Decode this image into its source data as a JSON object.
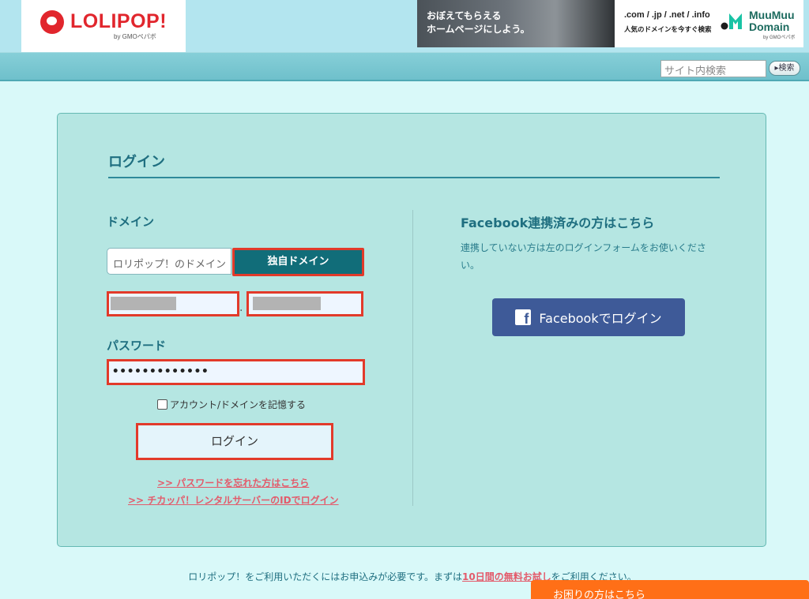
{
  "header": {
    "logo_text": "LOLIPOP!",
    "logo_sub": "by GMOペパボ",
    "banner": {
      "photo_text": "おぼえてもらえる\nホームページにしよう。",
      "tlds": ".com / .jp / .net / .info",
      "tagline": "人気のドメインを今すぐ検索",
      "brand": "MuuMuu\nDomain",
      "brand_sub": "by GMOペパボ"
    }
  },
  "search": {
    "placeholder": "サイト内検索",
    "button_label": "▸検索"
  },
  "login": {
    "title": "ログイン",
    "domain_label": "ドメイン",
    "tab_lolipop": "ロリポップ！のドメイン",
    "tab_own": "独自ドメイン",
    "domain_dot": ".",
    "password_label": "パスワード",
    "password_value": "•••••••••••••",
    "remember_label": "アカウント/ドメインを記憶する",
    "login_button": "ログイン",
    "forgot_link": ">>  パスワードを忘れた方はこちら",
    "chicappa_link": ">>  チカッパ！レンタルサーバーのIDでログイン"
  },
  "facebook": {
    "title": "Facebook連携済みの方はこちら",
    "note": "連携していない方は左のログインフォームをお使いください。",
    "button_label": "Facebookでログイン",
    "icon_letter": "f"
  },
  "footer": {
    "note_before": "ロリポップ！をご利用いただくにはお申込みが必要です。まずは",
    "note_link": "10日間の無料お試し",
    "note_after": "をご利用ください。",
    "help_tab": "お困りの方はこちら"
  },
  "colors": {
    "page_bg": "#d9f9f9",
    "panel_bg": "#b5e6e2",
    "accent_teal": "#116d79",
    "facebook_blue": "#3e5a98",
    "link_pink": "#e35b6b",
    "help_orange": "#ff6f17",
    "highlight_red": "#e23a2a"
  }
}
